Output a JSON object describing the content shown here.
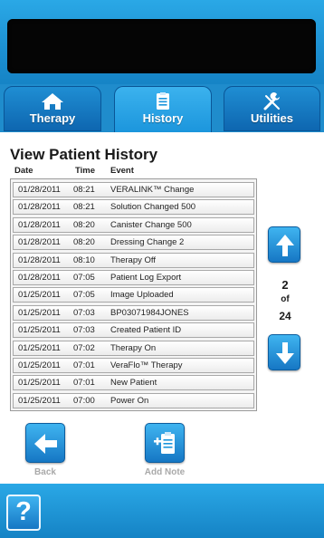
{
  "tabs": [
    {
      "label": "Therapy",
      "icon": "home-icon",
      "active": false
    },
    {
      "label": "History",
      "icon": "clipboard-icon",
      "active": true
    },
    {
      "label": "Utilities",
      "icon": "tools-icon",
      "active": false
    }
  ],
  "history": {
    "title": "View Patient History",
    "columns": {
      "date": "Date",
      "time": "Time",
      "event": "Event"
    },
    "rows": [
      {
        "date": "01/28/2011",
        "time": "08:21",
        "event": "VERALINK™ Change"
      },
      {
        "date": "01/28/2011",
        "time": "08:21",
        "event": "Solution Changed 500"
      },
      {
        "date": "01/28/2011",
        "time": "08:20",
        "event": "Canister Change 500"
      },
      {
        "date": "01/28/2011",
        "time": "08:20",
        "event": "Dressing Change 2"
      },
      {
        "date": "01/28/2011",
        "time": "08:10",
        "event": "Therapy Off"
      },
      {
        "date": "01/28/2011",
        "time": "07:05",
        "event": "Patient Log Export"
      },
      {
        "date": "01/25/2011",
        "time": "07:05",
        "event": "Image Uploaded"
      },
      {
        "date": "01/25/2011",
        "time": "07:03",
        "event": "BP03071984JONES"
      },
      {
        "date": "01/25/2011",
        "time": "07:03",
        "event": "Created Patient ID"
      },
      {
        "date": "01/25/2011",
        "time": "07:02",
        "event": "Therapy On"
      },
      {
        "date": "01/25/2011",
        "time": "07:01",
        "event": "VeraFlo™ Therapy"
      },
      {
        "date": "01/25/2011",
        "time": "07:01",
        "event": "New Patient"
      },
      {
        "date": "01/25/2011",
        "time": "07:00",
        "event": "Power On"
      }
    ]
  },
  "pager": {
    "current": "2",
    "of_label": "of",
    "total": "24"
  },
  "buttons": {
    "back_label": "Back",
    "add_note_label": "Add Note",
    "help_label": "?"
  },
  "colors": {
    "accent": "#1c8fd1",
    "dark_panel": "#050505",
    "disabled_text": "#a9a9a9"
  }
}
